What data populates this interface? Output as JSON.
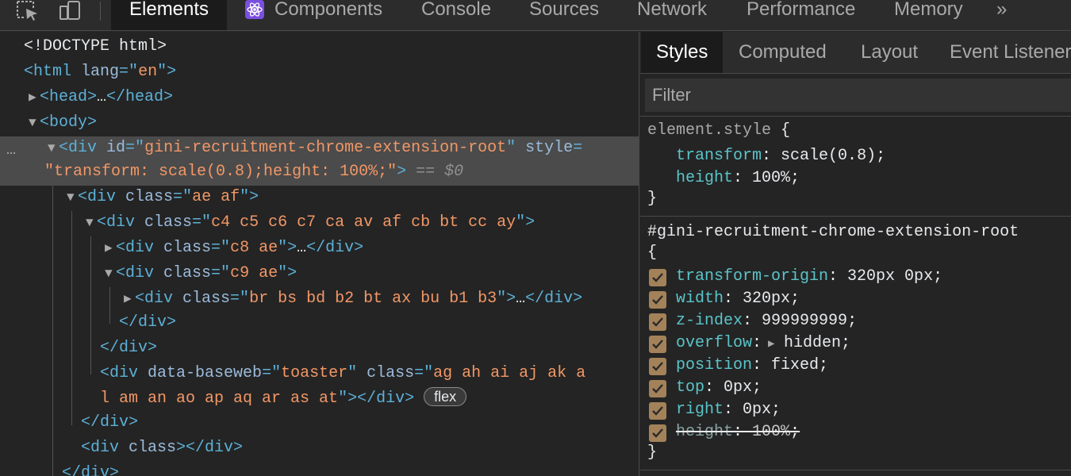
{
  "tabs": [
    {
      "label": "Elements",
      "active": true
    },
    {
      "label": "Components",
      "active": false
    },
    {
      "label": "Console",
      "active": false
    },
    {
      "label": "Sources",
      "active": false
    },
    {
      "label": "Network",
      "active": false
    },
    {
      "label": "Performance",
      "active": false
    },
    {
      "label": "Memory",
      "active": false
    }
  ],
  "overflow_chevron": "»",
  "icons": {
    "inspect": "inspect-element-icon",
    "device": "device-toolbar-icon",
    "react": "react-components-icon"
  },
  "dom": {
    "doctype": "<!DOCTYPE html>",
    "html_lang": "en",
    "ellipsis": "…",
    "root_id": "gini-recruitment-chrome-extension-root",
    "root_style": "transform: scale(0.8);height: 100%;",
    "eq_ref": "== $0",
    "class1": "ae af",
    "class2": "c4 c5 c6 c7 ca av af cb bt cc ay",
    "class3": "c8 ae",
    "class4": "c9 ae",
    "class5": "br bs bd b2 bt ax bu b1 b3",
    "baseweb": "toaster",
    "toaster_class_a": "ag ah ai aj ak a",
    "toaster_class_b": "l am an ao ap aq ar as at",
    "flex_badge": "flex",
    "row_menu": "…"
  },
  "styles": {
    "subtabs": [
      "Styles",
      "Computed",
      "Layout",
      "Event Listener"
    ],
    "filter_placeholder": "Filter",
    "element_style_selector": "element.style",
    "element_style": [
      {
        "prop": "transform",
        "value": "scale(0.8)"
      },
      {
        "prop": "height",
        "value": "100%"
      }
    ],
    "rule_selector": "#gini-recruitment-chrome-extension-root",
    "rule_props": [
      {
        "prop": "transform-origin",
        "value": "320px 0px",
        "checked": true
      },
      {
        "prop": "width",
        "value": "320px",
        "checked": true
      },
      {
        "prop": "z-index",
        "value": "999999999",
        "checked": true
      },
      {
        "prop": "overflow",
        "value": "hidden",
        "checked": true,
        "expandable": true
      },
      {
        "prop": "position",
        "value": "fixed",
        "checked": true
      },
      {
        "prop": "top",
        "value": "0px",
        "checked": true
      },
      {
        "prop": "right",
        "value": "0px",
        "checked": true
      },
      {
        "prop": "height",
        "value": "100%",
        "checked": true,
        "overridden": true
      }
    ]
  },
  "colors": {
    "checkbox": "#a3825a",
    "property": "#5bc4c9",
    "attr_value": "#f29766",
    "tag": "#5db0d7"
  }
}
